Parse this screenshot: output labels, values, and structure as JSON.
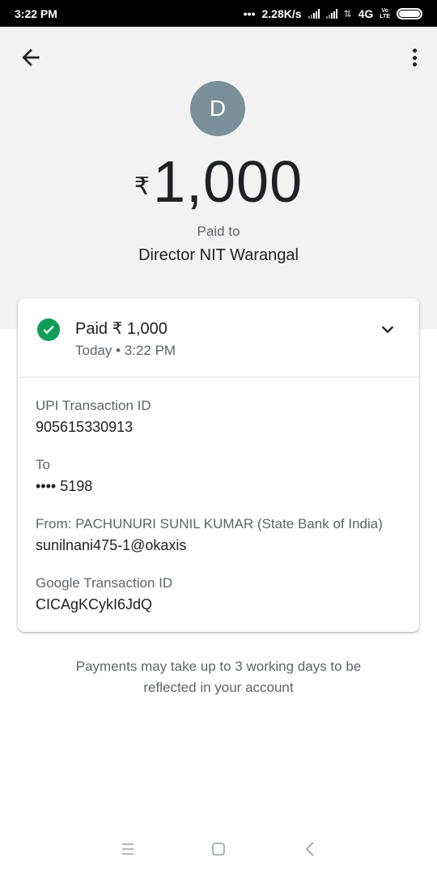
{
  "status_bar": {
    "time": "3:22 PM",
    "net_speed": "2.28K/s",
    "network": "4G",
    "volte_top": "Vo",
    "volte_bottom": "LTE"
  },
  "payment": {
    "avatar_letter": "D",
    "currency_symbol": "₹",
    "amount": "1,000",
    "paid_to_label": "Paid to",
    "payee_name": "Director NIT Warangal"
  },
  "card": {
    "status_title": "Paid ₹ 1,000",
    "status_time": "Today • 3:22 PM",
    "fields": [
      {
        "label": "UPI Transaction ID",
        "value": "905615330913"
      },
      {
        "label": "To",
        "value": "•••• 5198"
      },
      {
        "label": "From: PACHUNURI  SUNIL KUMAR (State Bank of India)",
        "value": "sunilnani475-1@okaxis"
      },
      {
        "label": "Google Transaction ID",
        "value": "CICAgKCykI6JdQ"
      }
    ]
  },
  "note": {
    "line1": "Payments may take up to 3 working days to be",
    "line2": "reflected in your account"
  },
  "colors": {
    "success": "#0f9d58",
    "avatar_bg": "#7a8f99",
    "header_bg": "#f2f2f2"
  },
  "icons": [
    "back-arrow-icon",
    "more-vert-icon",
    "check-circle-icon",
    "chevron-down-icon",
    "menu-icon",
    "home-square-icon",
    "back-chevron-icon"
  ]
}
